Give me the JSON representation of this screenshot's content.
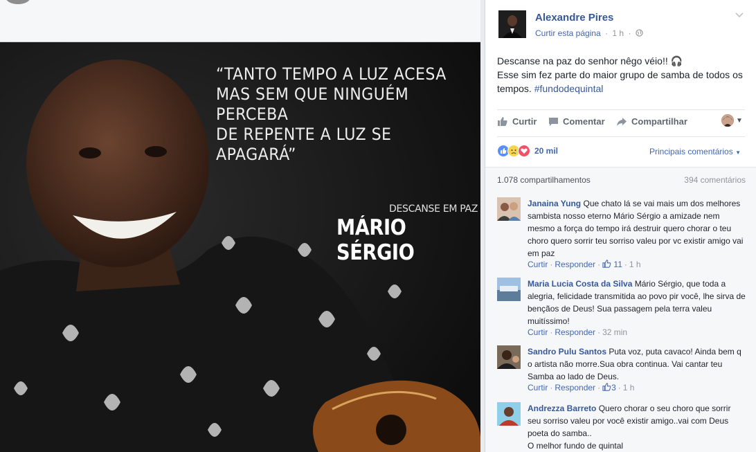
{
  "photo": {
    "quote_lines": [
      "“TANTO TEMPO A LUZ ACESA",
      "MAS SEM QUE NINGUÉM PERCEBA",
      "DE REPENTE A LUZ SE APAGARÁ”"
    ],
    "caption_small": "DESCANSE EM PAZ",
    "caption_name": "MÁRIO SÉRGIO"
  },
  "post": {
    "author": "Alexandre Pires",
    "like_page_label": "Curtir esta página",
    "time": "1 h",
    "text_line1": "Descanse na paz do senhor nêgo véio!! 🎧",
    "text_line2": "Esse sim fez parte do maior grupo de samba de todos os tempos.",
    "hashtag": "#fundodequintal",
    "actions": {
      "like": "Curtir",
      "comment": "Comentar",
      "share": "Compartilhar"
    },
    "reaction_count": "20 mil",
    "top_comments_label": "Principais comentários",
    "shares": "1.078 compartilhamentos",
    "comments_count": "394 comentários"
  },
  "comments": [
    {
      "author": "Janaina Yung",
      "text": "Que chato lá se vai mais um dos melhores sambista nosso eterno Mário Sérgio a amizade nem mesmo a força do tempo irá destruir quero chorar o teu choro quero sorrir teu sorriso valeu por vc existir amigo vai em paz",
      "like": "Curtir",
      "reply": "Responder",
      "likes": "11",
      "time": "1 h"
    },
    {
      "author": "Maria Lucia Costa da Silva",
      "text": "Mário Sérgio, que toda a alegria, felicidade transmitida ao povo pir você, lhe sirva de bençãos de Deus! Sua passagem pela terra valeu muitíssimo!",
      "like": "Curtir",
      "reply": "Responder",
      "likes": "",
      "time": "32 min"
    },
    {
      "author": "Sandro Pulu Santos",
      "text": "Puta voz, puta cavaco! Ainda bem q o artista não morre.Sua obra continua. Vai cantar teu Samba ao lado de Deus.",
      "like": "Curtir",
      "reply": "Responder",
      "likes": "3",
      "time": "1 h"
    },
    {
      "author": "Andrezza Barreto",
      "text": "Quero chorar o seu choro que sorrir seu sorriso valeu por você existir amigo..vai com Deus poeta do samba..",
      "text2": "O melhor fundo de quintal"
    }
  ],
  "colors": {
    "link": "#365899",
    "accent": "#4267b2",
    "muted": "#90949c",
    "like_reaction": "#5890ff",
    "sad_reaction": "#f7d44e",
    "love_reaction": "#f25268"
  }
}
